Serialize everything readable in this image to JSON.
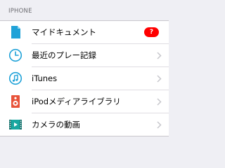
{
  "section": {
    "header": "IPHONE"
  },
  "rows": [
    {
      "label": "マイドキュメント",
      "icon": "document-icon",
      "badge": "?"
    },
    {
      "label": "最近のプレー記録",
      "icon": "clock-icon"
    },
    {
      "label": "iTunes",
      "icon": "music-note-icon"
    },
    {
      "label": "iPodメディアライブラリ",
      "icon": "speaker-icon"
    },
    {
      "label": "カメラの動画",
      "icon": "film-strip-icon"
    }
  ],
  "colors": {
    "accent": "#20a2d8",
    "speaker_red": "#e8533a",
    "badge": "#ff0000",
    "background": "#efeff4"
  }
}
